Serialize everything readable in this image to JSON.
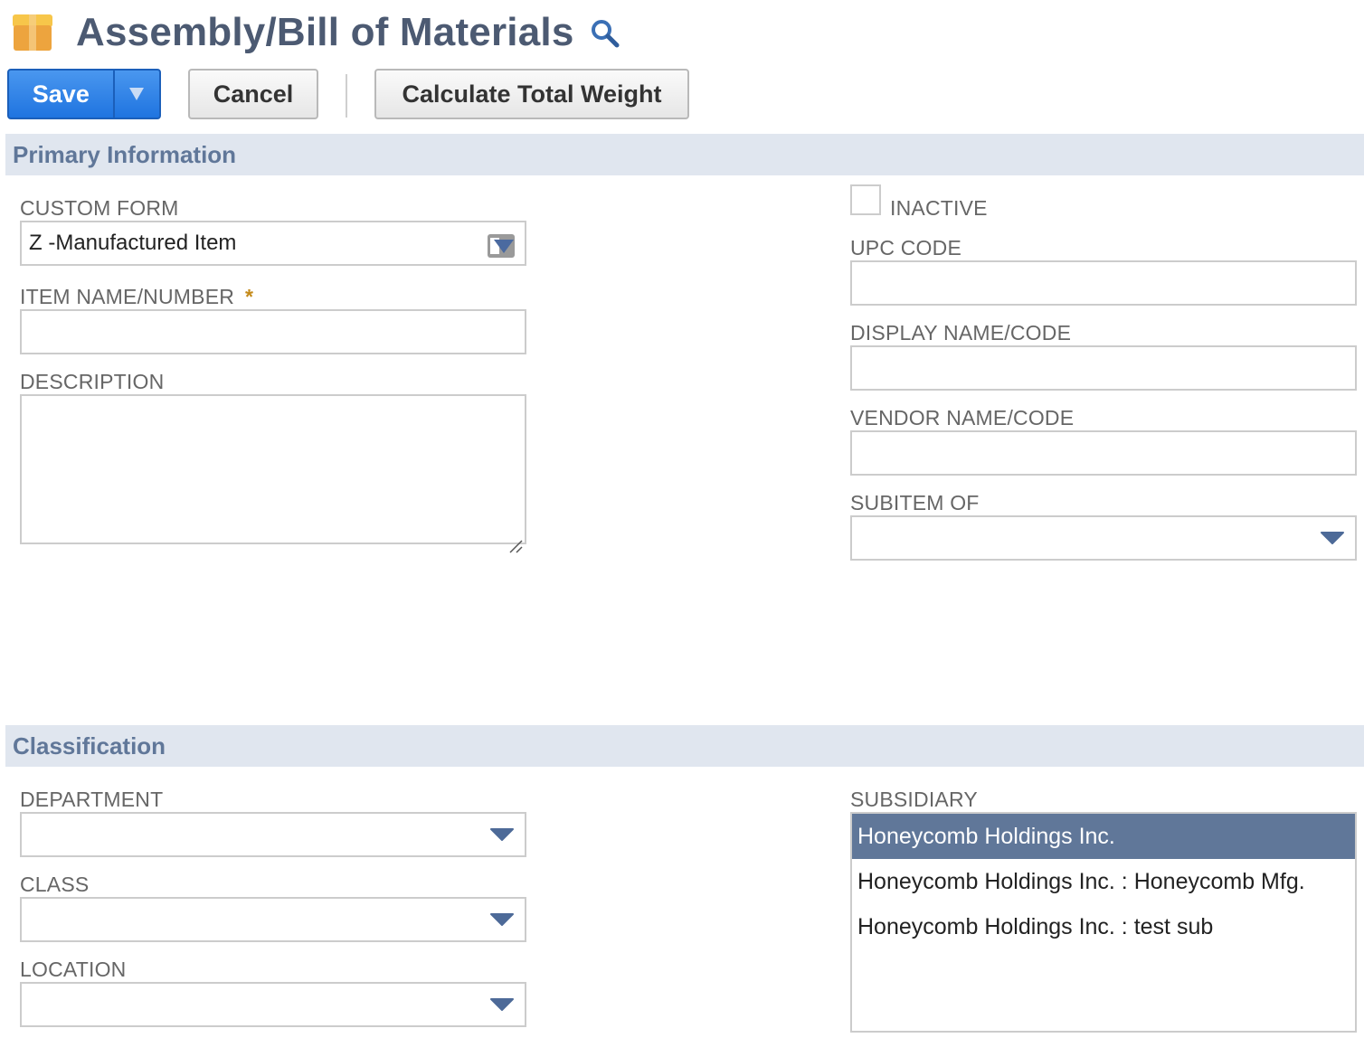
{
  "header": {
    "title": "Assembly/Bill of Materials",
    "icon": "package-box-icon",
    "search_icon": "search-icon"
  },
  "toolbar": {
    "save_label": "Save",
    "save_menu_icon": "triangle-down-icon",
    "cancel_label": "Cancel",
    "calculate_label": "Calculate Total Weight"
  },
  "colors": {
    "primary_button": "#2a80e8",
    "section_header_bg": "#e0e6ef",
    "section_header_text": "#607799",
    "selected_option_bg": "#607799",
    "required_star": "#c48a1a"
  },
  "sections": {
    "primary": {
      "title": "Primary Information",
      "fields": {
        "custom_form": {
          "label": "CUSTOM FORM",
          "value": "Z -Manufactured Item"
        },
        "item_name": {
          "label": "ITEM NAME/NUMBER",
          "required_marker": "*",
          "value": ""
        },
        "description": {
          "label": "DESCRIPTION",
          "value": ""
        },
        "inactive": {
          "label": "INACTIVE",
          "checked": false
        },
        "upc_code": {
          "label": "UPC CODE",
          "value": ""
        },
        "display_name": {
          "label": "DISPLAY NAME/CODE",
          "value": ""
        },
        "vendor_name": {
          "label": "VENDOR NAME/CODE",
          "value": ""
        },
        "subitem_of": {
          "label": "SUBITEM OF",
          "value": ""
        }
      }
    },
    "classification": {
      "title": "Classification",
      "fields": {
        "department": {
          "label": "DEPARTMENT",
          "value": ""
        },
        "class": {
          "label": "CLASS",
          "value": ""
        },
        "location": {
          "label": "LOCATION",
          "value": ""
        },
        "subsidiary": {
          "label": "SUBSIDIARY",
          "options": [
            {
              "label": "Honeycomb Holdings Inc.",
              "selected": true
            },
            {
              "label": "Honeycomb Holdings Inc. : Honeycomb Mfg.",
              "selected": false
            },
            {
              "label": "Honeycomb Holdings Inc. : test sub",
              "selected": false
            }
          ]
        }
      }
    }
  }
}
